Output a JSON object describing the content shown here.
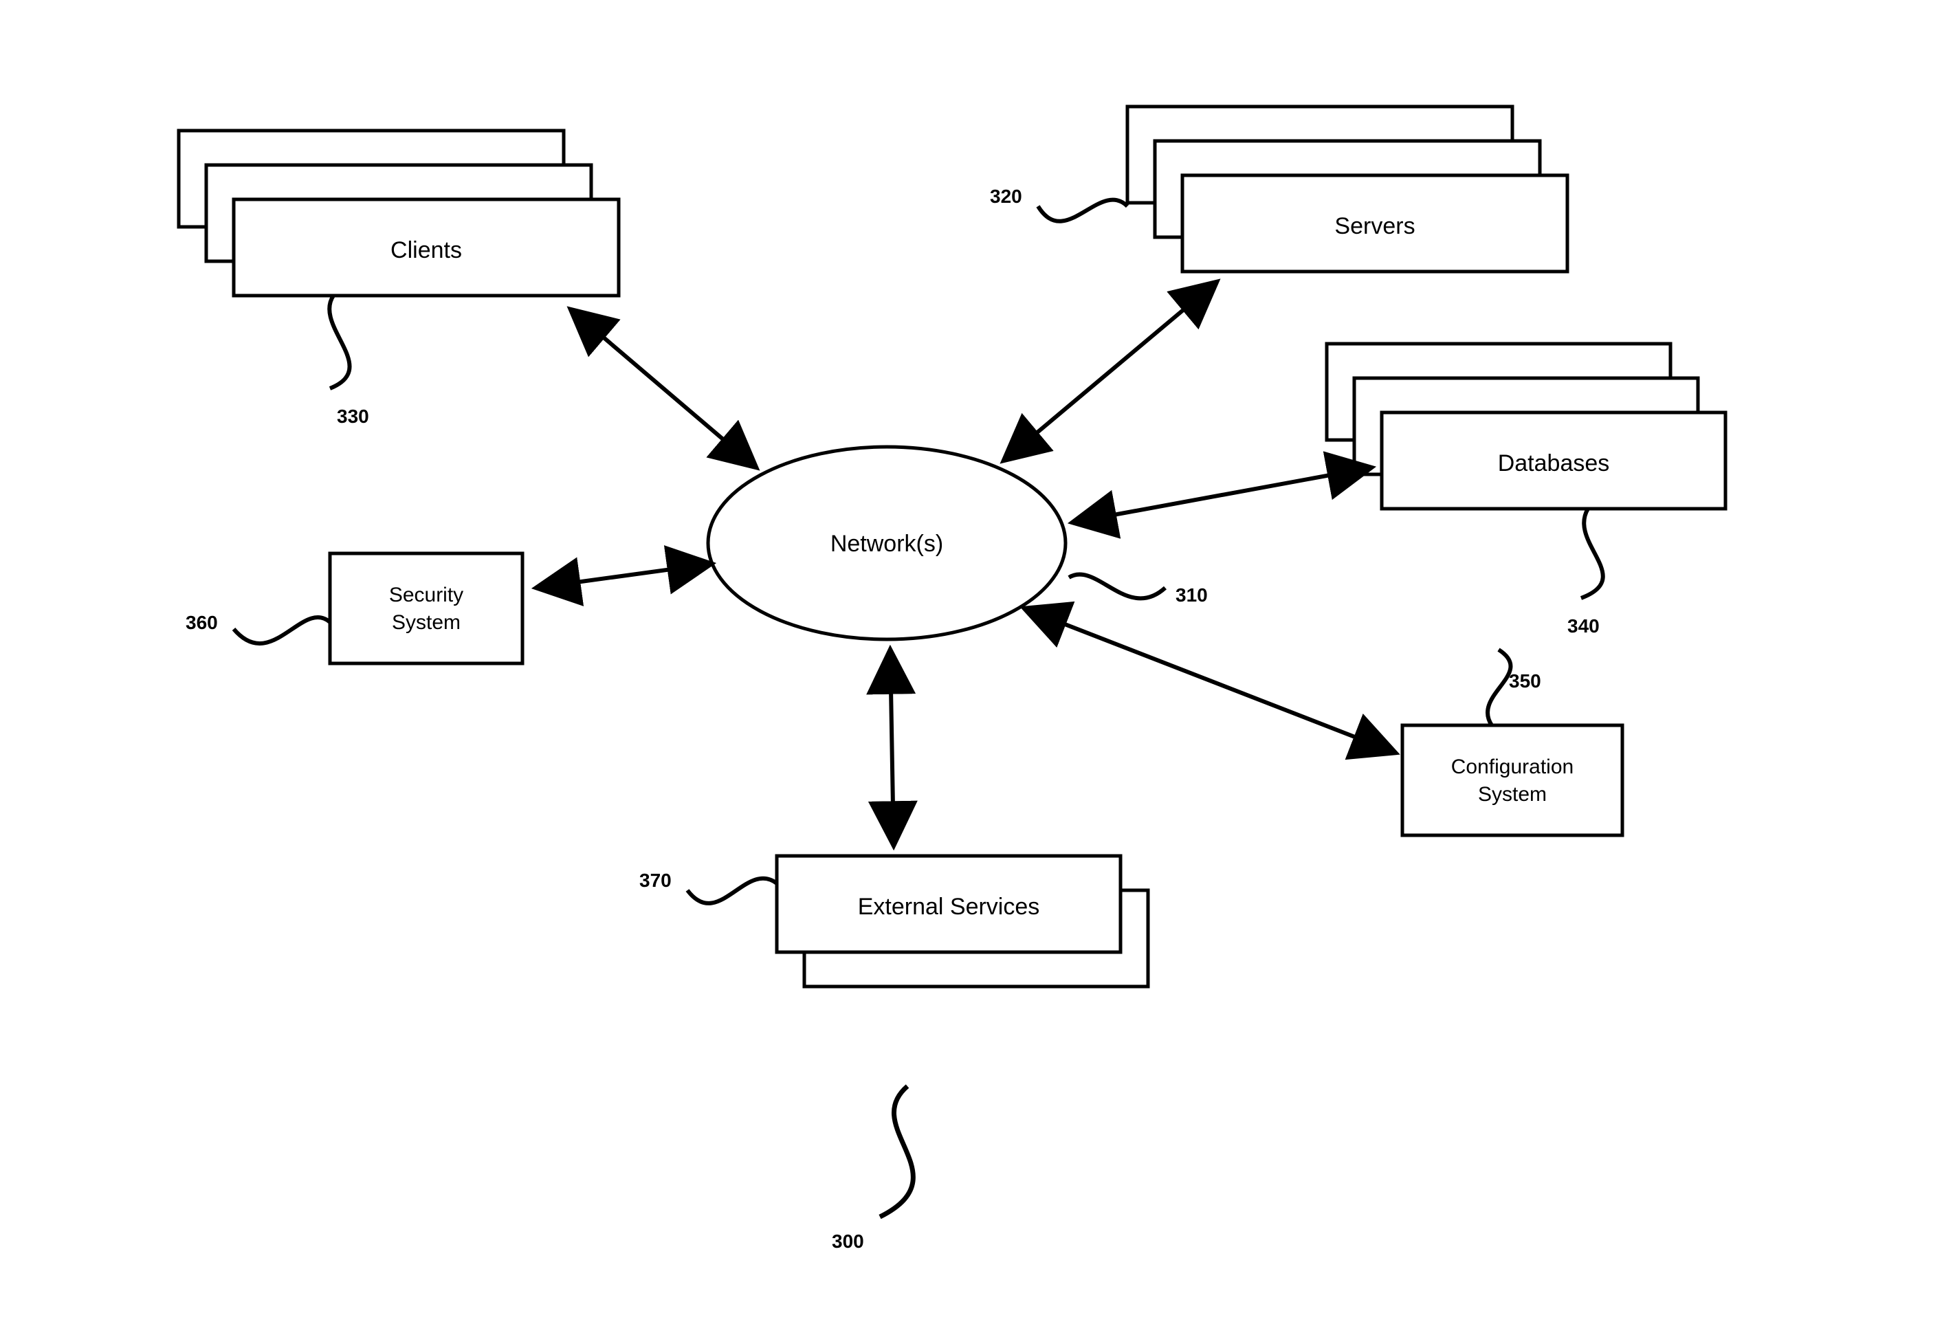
{
  "diagram": {
    "center": {
      "label": "Network(s)",
      "ref": "310"
    },
    "clients": {
      "label": "Clients",
      "ref": "330"
    },
    "servers": {
      "label": "Servers",
      "ref": "320"
    },
    "databases": {
      "label": "Databases",
      "ref": "340"
    },
    "security": {
      "line1": "Security",
      "line2": "System",
      "ref": "360"
    },
    "config": {
      "line1": "Configuration",
      "line2": "System",
      "ref": "350"
    },
    "external": {
      "label": "External Services",
      "ref": "370"
    },
    "figure_ref": "300"
  }
}
